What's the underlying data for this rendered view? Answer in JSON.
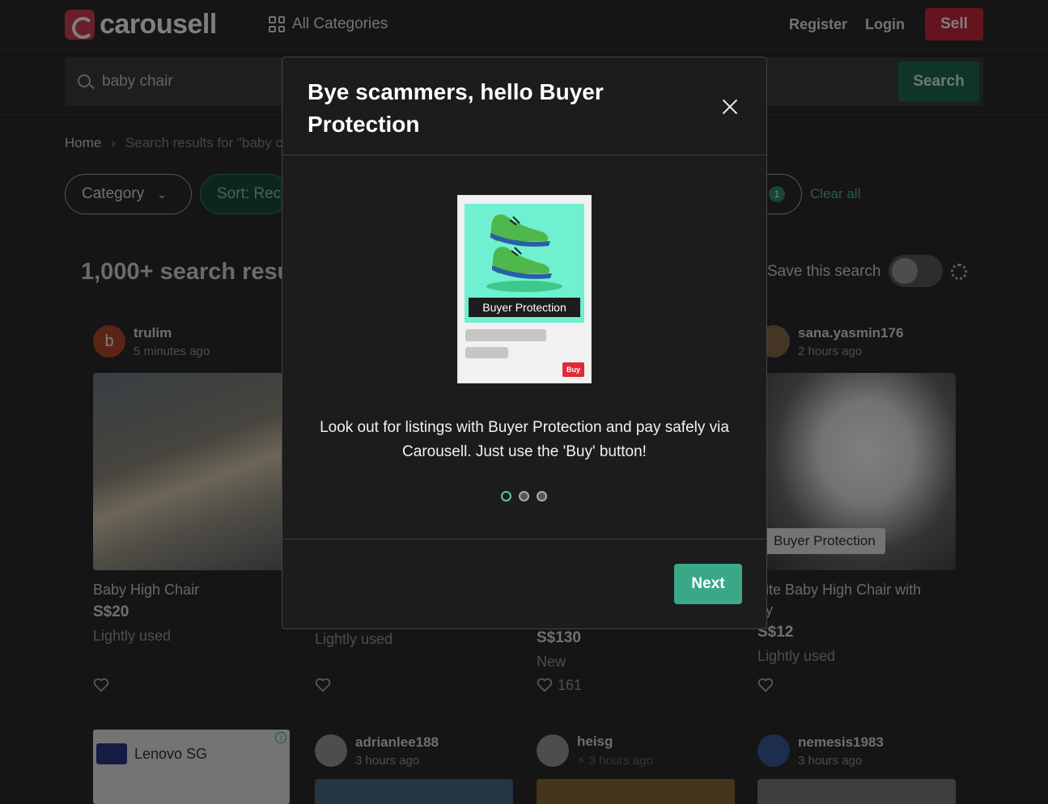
{
  "header": {
    "logo_text": "carousell",
    "all_categories": "All Categories",
    "register": "Register",
    "login": "Login",
    "sell": "Sell"
  },
  "search": {
    "value": "baby chair",
    "button": "Search"
  },
  "breadcrumb": {
    "home": "Home",
    "separator": "›",
    "current": "Search results for \"baby c"
  },
  "filters": {
    "category": "Category",
    "sort": "Sort: Rece",
    "badge_count": "1",
    "clear_all": "Clear all"
  },
  "results": {
    "count": "1,000+ search resu",
    "save_search": "Save this search"
  },
  "listings": [
    {
      "avatar_letter": "b",
      "seller": "trulim",
      "time": "5 minutes ago",
      "title": "Baby High Chair",
      "price": "S$20",
      "condition": "Lightly used"
    },
    {
      "condition": "Lightly used"
    },
    {
      "price": "S$130",
      "condition": "New",
      "likes": "161"
    },
    {
      "seller": "sana.yasmin176",
      "time": "2 hours ago",
      "badge": "Buyer Protection",
      "title": "hite Baby High Chair with",
      "title2": "ay",
      "price": "S$12",
      "condition": "Lightly used"
    }
  ],
  "row2": [
    {
      "seller": "Lenovo SG"
    },
    {
      "seller": "adrianlee188",
      "time": "3 hours ago"
    },
    {
      "seller": "heisg",
      "time": "3 hours ago"
    },
    {
      "seller": "nemesis1983",
      "time": "3 hours ago"
    }
  ],
  "modal": {
    "title": "Bye scammers, hello Buyer Protection",
    "illustration_label": "Buyer Protection",
    "illustration_buy": "Buy",
    "body": "Look out for listings with Buyer Protection and pay safely via Carousell. Just use the 'Buy' button!",
    "next": "Next",
    "active_step": 1,
    "total_steps": 3
  },
  "colors": {
    "brand_red": "#d23f57",
    "accent_green": "#3aa886",
    "modal_bg": "#1c1c1c"
  }
}
